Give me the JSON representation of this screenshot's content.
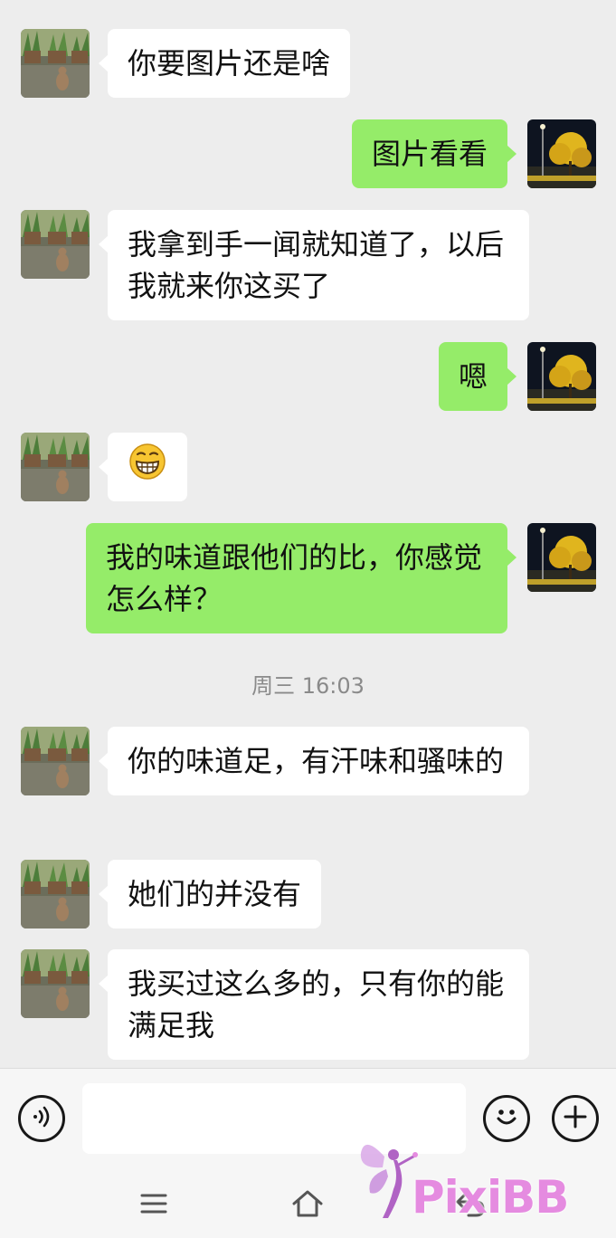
{
  "conversation": {
    "messages": [
      {
        "side": "in",
        "text": "你要图片还是啥"
      },
      {
        "side": "out",
        "text": "图片看看"
      },
      {
        "side": "in",
        "text": "我拿到手一闻就知道了，以后我就来你这买了"
      },
      {
        "side": "out",
        "text": "嗯"
      },
      {
        "side": "in",
        "emoji": "grinning-face-emoji"
      },
      {
        "side": "out",
        "text": "我的味道跟他们的比，你感觉怎么样？"
      },
      {
        "side": "in",
        "text": "你的味道足，有汗味和骚味的"
      },
      {
        "side": "in",
        "text": "她们的并没有"
      },
      {
        "side": "in",
        "text": "我买过这么多的，只有你的能满足我"
      }
    ],
    "timestamp": "周三  16:03"
  },
  "input_bar": {
    "voice_icon": "voice-wave-icon",
    "emoji_icon": "smiley-icon",
    "plus_icon": "plus-icon",
    "message_value": ""
  },
  "nav": {
    "menu_icon": "menu-icon",
    "home_icon": "home-icon",
    "back_icon": "back-icon"
  },
  "watermark": {
    "text": "PixiBB",
    "color": "#e58be0"
  },
  "colors": {
    "background": "#ededed",
    "incoming_bubble": "#ffffff",
    "outgoing_bubble": "#95ec69"
  }
}
